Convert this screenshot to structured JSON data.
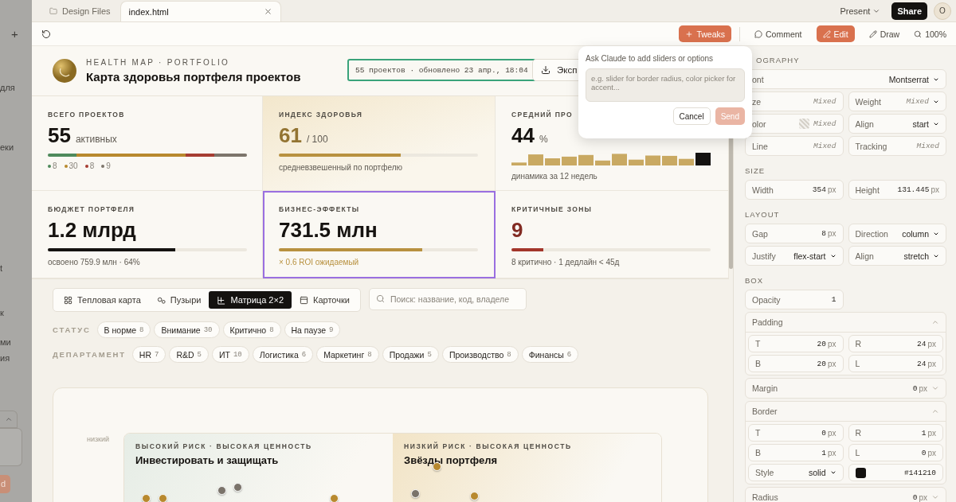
{
  "left_panel": {
    "fragments": [
      {
        "text": "+",
        "kind": "text"
      },
      {
        "text": "для",
        "kind": "text"
      },
      {
        "text": "еки",
        "kind": "text"
      },
      {
        "text": "t",
        "kind": "text"
      },
      {
        "text": "к",
        "kind": "text"
      },
      {
        "text": "ми",
        "kind": "text"
      },
      {
        "text": "ия",
        "kind": "text"
      },
      {
        "text": "d",
        "kind": "button"
      }
    ]
  },
  "tabs": [
    {
      "label": "Design Files",
      "selected": false,
      "closable": false
    },
    {
      "label": "index.html",
      "selected": true,
      "closable": true
    }
  ],
  "top_right": {
    "present": "Present",
    "share": "Share",
    "avatar": "O"
  },
  "toolbar": {
    "tweaks": "Tweaks",
    "tools": [
      {
        "label": "Comment",
        "selected": false
      },
      {
        "label": "Edit",
        "selected": true
      },
      {
        "label": "Draw",
        "selected": false
      }
    ],
    "zoom": "100%"
  },
  "header": {
    "eyebrow": "HEALTH MAP · PORTFOLIO",
    "title": "Карта здоровья портфеля проектов",
    "status": "55 проектов · обновлено 23 апр., 18:04",
    "export": "Эксп"
  },
  "stats": [
    {
      "kind": "segments",
      "label": "ВСЕГО ПРОЕКТОВ",
      "value": "55",
      "unit": "активных",
      "emphasis": false,
      "selected": false,
      "highlighted": false,
      "segments": [
        {
          "value": "8",
          "color": "#4e8a5c"
        },
        {
          "value": "30",
          "color": "#b8892e"
        },
        {
          "value": "8",
          "color": "#a63d32"
        },
        {
          "value": "9",
          "color": "#7c756b"
        }
      ]
    },
    {
      "kind": "progress",
      "label": "ИНДЕКС ЗДОРОВЬЯ",
      "value": "61",
      "unit": "/ 100",
      "color": "#b8913f",
      "emphasis": true,
      "caption_accent": false,
      "selected": false,
      "highlighted": true,
      "level": 0.61,
      "caption": "средневзвешенный по портфелю"
    },
    {
      "kind": "sparkline",
      "label": "СРЕДНИЙ ПРО",
      "value": "44",
      "unit": "%",
      "emphasis": false,
      "caption_accent": false,
      "selected": false,
      "highlighted": false,
      "caption": "динамика за 12 недель"
    },
    {
      "kind": "progress",
      "label": "БЮДЖЕТ ПОРТФЕЛЯ",
      "value": "1.2 млрд",
      "color": "#141210",
      "emphasis": false,
      "caption_accent": false,
      "selected": false,
      "highlighted": false,
      "level": 0.64,
      "caption": "освоено 759.9 млн · 64%"
    },
    {
      "kind": "progress",
      "label": "БИЗНЕС-ЭФФЕКТЫ",
      "value": "731.5 млн",
      "color": "#b8913f",
      "emphasis": false,
      "caption_accent": true,
      "selected": true,
      "highlighted": false,
      "level": 0.72,
      "caption": "× 0.6 ROI ожидаемый"
    },
    {
      "kind": "progress",
      "label": "КРИТИЧНЫЕ ЗОНЫ",
      "value": "9",
      "color": "#a3362b",
      "emphasis": true,
      "caption_accent": false,
      "selected": false,
      "highlighted": false,
      "level": 0.16,
      "caption": "8 критично · 1 дедлайн < 45д"
    }
  ],
  "views": [
    {
      "label": "Тепловая карта",
      "selected": false
    },
    {
      "label": "Пузыри",
      "selected": false
    },
    {
      "label": "Матрица 2×2",
      "selected": true
    },
    {
      "label": "Карточки",
      "selected": false
    }
  ],
  "search": {
    "placeholder": "Поиск: название, код, владеле"
  },
  "filters": [
    {
      "label": "СТАТУС",
      "chips": [
        {
          "label": "В норме",
          "count": "8"
        },
        {
          "label": "Внимание",
          "count": "30"
        },
        {
          "label": "Критично",
          "count": "8"
        },
        {
          "label": "На паузе",
          "count": "9"
        }
      ]
    },
    {
      "label": "ДЕПАРТАМЕНТ",
      "chips": [
        {
          "label": "HR",
          "count": "7"
        },
        {
          "label": "R&D",
          "count": "5"
        },
        {
          "label": "ИТ",
          "count": "10"
        },
        {
          "label": "Логистика",
          "count": "6"
        },
        {
          "label": "Маркетинг",
          "count": "8"
        },
        {
          "label": "Продажи",
          "count": "5"
        },
        {
          "label": "Производство",
          "count": "8"
        },
        {
          "label": "Финансы",
          "count": "6"
        }
      ]
    }
  ],
  "matrix": {
    "axis_label": "низкий",
    "quadrants": [
      {
        "eyebrow": "ВЫСОКИЙ РИСК · ВЫСОКАЯ ЦЕННОСТЬ",
        "title": "Инвестировать и защищать",
        "color": "#e6ede6",
        "dots": [
          {
            "color": "#b8892e"
          },
          {
            "color": "#b8892e"
          },
          {
            "color": "#7a736a"
          },
          {
            "color": "#7a736a"
          },
          {
            "color": "#b8892e"
          }
        ]
      },
      {
        "eyebrow": "НИЗКИЙ РИСК · ВЫСОКАЯ ЦЕННОСТЬ",
        "title": "Звёзды портфеля",
        "color": "#f2e4c6",
        "dots": [
          {
            "color": "#b8892e"
          },
          {
            "color": "#7a736a"
          },
          {
            "color": "#b8892e"
          }
        ]
      }
    ]
  },
  "popup": {
    "title": "Ask Claude to add sliders or options",
    "placeholder": "e.g. slider for border radius, color picker for accent...",
    "cancel": "Cancel",
    "send": "Send",
    "send_disabled": true
  },
  "inspector": {
    "sections": [
      {
        "title": "OGRAPHY",
        "rows": [
          [
            {
              "label": "ont",
              "value": "Montserrat",
              "kind": "select",
              "full": true
            }
          ],
          [
            {
              "label": "ze",
              "value": "Mixed",
              "kind": "plain",
              "mixed": true
            },
            {
              "label": "Weight",
              "value": "Mixed",
              "kind": "select",
              "mixed": true
            }
          ],
          [
            {
              "label": "olor",
              "value": "Mixed",
              "kind": "plain",
              "mixed": true,
              "swatch": true
            },
            {
              "label": "Align",
              "value": "start",
              "kind": "select"
            }
          ],
          [
            {
              "label": "Line",
              "value": "Mixed",
              "kind": "plain",
              "mixed": true
            },
            {
              "label": "Tracking",
              "value": "Mixed",
              "kind": "plain",
              "mixed": true
            }
          ]
        ]
      },
      {
        "title": "SIZE",
        "rows": [
          [
            {
              "label": "Width",
              "value": "354",
              "unit": "px",
              "kind": "number"
            },
            {
              "label": "Height",
              "value": "131.445",
              "unit": "px",
              "kind": "number"
            }
          ]
        ]
      },
      {
        "title": "LAYOUT",
        "rows": [
          [
            {
              "label": "Gap",
              "value": "8",
              "unit": "px",
              "kind": "number"
            },
            {
              "label": "Direction",
              "value": "column",
              "kind": "select"
            }
          ],
          [
            {
              "label": "Justify",
              "value": "flex-start",
              "kind": "select"
            },
            {
              "label": "Align",
              "value": "stretch",
              "kind": "select"
            }
          ]
        ]
      },
      {
        "title": "BOX",
        "rows": [
          [
            {
              "label": "Opacity",
              "value": "1",
              "kind": "number"
            }
          ],
          [
            {
              "kind": "group",
              "title": "Padding",
              "expanded": true,
              "rows": [
                [
                  {
                    "label": "T",
                    "value": "20",
                    "unit": "px",
                    "kind": "number"
                  },
                  {
                    "label": "R",
                    "value": "24",
                    "unit": "px",
                    "kind": "number"
                  }
                ],
                [
                  {
                    "label": "B",
                    "value": "20",
                    "unit": "px",
                    "kind": "number"
                  },
                  {
                    "label": "L",
                    "value": "24",
                    "unit": "px",
                    "kind": "number"
                  }
                ]
              ]
            }
          ],
          [
            {
              "kind": "group",
              "title": "Margin",
              "expanded": false,
              "value": "0",
              "unit": "px"
            }
          ],
          [
            {
              "kind": "group",
              "title": "Border",
              "expanded": true,
              "rows": [
                [
                  {
                    "label": "T",
                    "value": "0",
                    "unit": "px",
                    "kind": "number"
                  },
                  {
                    "label": "R",
                    "value": "1",
                    "unit": "px",
                    "kind": "number"
                  }
                ],
                [
                  {
                    "label": "B",
                    "value": "1",
                    "unit": "px",
                    "kind": "number"
                  },
                  {
                    "label": "L",
                    "value": "0",
                    "unit": "px",
                    "kind": "number"
                  }
                ],
                [
                  {
                    "label": "Style",
                    "value": "solid",
                    "kind": "select"
                  },
                  {
                    "value": "#141210",
                    "kind": "number",
                    "swatch": true
                  }
                ]
              ]
            }
          ],
          [
            {
              "kind": "group",
              "title": "Radius",
              "expanded": false,
              "value": "0",
              "unit": "px"
            }
          ]
        ]
      }
    ]
  }
}
